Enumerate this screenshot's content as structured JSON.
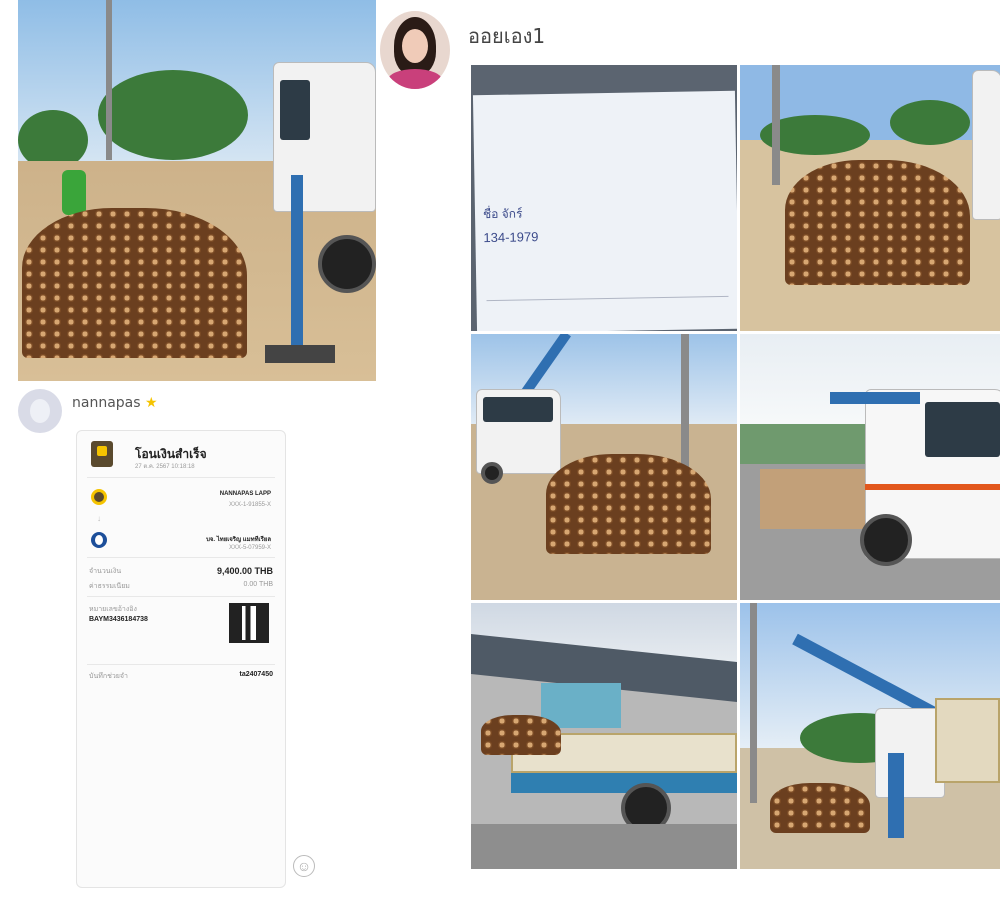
{
  "posts": [
    {
      "username": "nannapas",
      "badge_icon": "star-icon",
      "receipt": {
        "title": "โอนเงินสำเร็จ",
        "datetime": "27 ต.ค. 2567 10:18:18",
        "from_name": "NANNAPAS LAPP",
        "from_account": "XXX-1-91855-X",
        "to_name": "บจ. ไทยเจริญ แมททีเรียล",
        "to_account": "XXX-5-07959-X",
        "amount_label": "จำนวนเงิน",
        "amount": "9,400.00 THB",
        "fee_label": "ค่าธรรมเนียม",
        "fee": "0.00 THB",
        "ref_label": "หมายเลขอ้างอิง",
        "ref": "BAYM3436184738",
        "memo_label": "บันทึกช่วยจำ",
        "memo": "ta2407450"
      }
    },
    {
      "username": "ออยเอง1"
    }
  ],
  "bill_photo": {
    "text_lines": [
      "ชื่อ จักร์",
      "134-1979"
    ]
  },
  "colors": {
    "accent": "#f5c400",
    "krungsri_yellow": "#f5c400",
    "crane_blue": "#2f6fb1"
  }
}
